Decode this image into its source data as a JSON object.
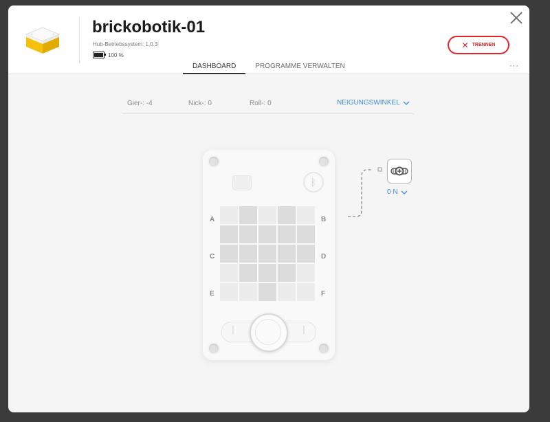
{
  "hub": {
    "name": "brickobotik-01",
    "os_version": "Hub-Betriebssystem: 1.0.3",
    "battery": "100 %"
  },
  "actions": {
    "disconnect_label": "TRENNEN",
    "close_icon": "close-icon",
    "more_label": "···"
  },
  "tabs": [
    {
      "label": "DASHBOARD",
      "active": true
    },
    {
      "label": "PROGRAMME VERWALTEN",
      "active": false
    }
  ],
  "angles": {
    "yaw": "Gier-: -4",
    "pitch": "Nick-: 0",
    "roll": "Roll-: 0",
    "mode_label": "NEIGUNGSWINKEL"
  },
  "ports": [
    "A",
    "B",
    "C",
    "D",
    "E",
    "F"
  ],
  "matrix": [
    [
      0,
      1,
      0,
      1,
      0
    ],
    [
      1,
      1,
      1,
      1,
      1
    ],
    [
      1,
      1,
      1,
      1,
      1
    ],
    [
      0,
      1,
      1,
      1,
      0
    ],
    [
      0,
      0,
      1,
      0,
      0
    ]
  ],
  "motor": {
    "value": "0 N"
  },
  "colors": {
    "accent": "#3a8ce6",
    "danger": "#e2232a",
    "hub_yellow": "#f4c20d"
  }
}
